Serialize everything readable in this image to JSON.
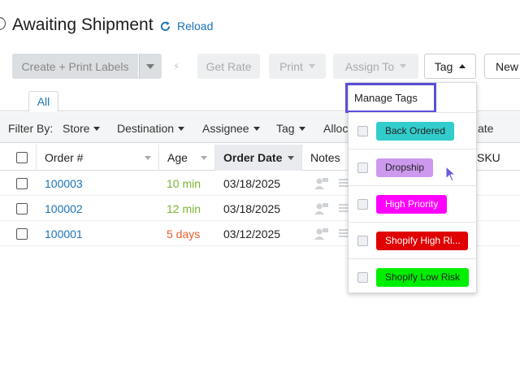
{
  "header": {
    "title": "Awaiting Shipment",
    "reload_label": "Reload"
  },
  "toolbar": {
    "create_label": "Create + Print Labels",
    "get_rate_label": "Get Rate",
    "print_label": "Print",
    "assign_label": "Assign To",
    "tag_label": "Tag",
    "new_label": "New"
  },
  "tabs": {
    "all_label": "All"
  },
  "filters": {
    "label": "Filter By:",
    "store": "Store",
    "destination": "Destination",
    "assignee": "Assignee",
    "tag": "Tag",
    "alloc": "Alloc",
    "ate": "ate"
  },
  "columns": {
    "order": "Order #",
    "age": "Age",
    "order_date": "Order Date",
    "notes": "Notes",
    "sku": "SKU"
  },
  "orders": [
    {
      "number": "100003",
      "age": "10 min",
      "age_status": "green",
      "date": "03/18/2025"
    },
    {
      "number": "100002",
      "age": "12 min",
      "age_status": "green",
      "date": "03/18/2025"
    },
    {
      "number": "100001",
      "age": "5 days",
      "age_status": "red",
      "date": "03/12/2025"
    }
  ],
  "tag_menu": {
    "manage_label": "Manage Tags",
    "tags": [
      {
        "label": "Back Ordered",
        "color": "#33cccc",
        "text_color": "#222222"
      },
      {
        "label": "Dropship",
        "color": "#cc99ee",
        "text_color": "#222222"
      },
      {
        "label": "High Priority",
        "color": "#ff00ff",
        "text_color": "#ffffff"
      },
      {
        "label": "Shopify High Ri...",
        "color": "#e00000",
        "text_color": "#ffffff"
      },
      {
        "label": "Shopify Low Risk",
        "color": "#00ee00",
        "text_color": "#222222"
      }
    ]
  },
  "colors": {
    "link": "#1a73b8",
    "age_green": "#7ab433",
    "age_red": "#e85d2a",
    "highlight_border": "#5a4fd8"
  }
}
